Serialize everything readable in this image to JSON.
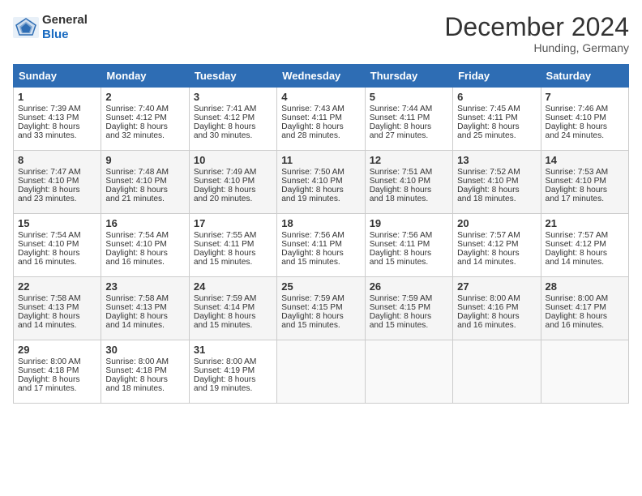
{
  "header": {
    "logo_general": "General",
    "logo_blue": "Blue",
    "title": "December 2024",
    "location": "Hunding, Germany"
  },
  "days_of_week": [
    "Sunday",
    "Monday",
    "Tuesday",
    "Wednesday",
    "Thursday",
    "Friday",
    "Saturday"
  ],
  "weeks": [
    [
      {
        "day": "1",
        "lines": [
          "Sunrise: 7:39 AM",
          "Sunset: 4:13 PM",
          "Daylight: 8 hours",
          "and 33 minutes."
        ]
      },
      {
        "day": "2",
        "lines": [
          "Sunrise: 7:40 AM",
          "Sunset: 4:12 PM",
          "Daylight: 8 hours",
          "and 32 minutes."
        ]
      },
      {
        "day": "3",
        "lines": [
          "Sunrise: 7:41 AM",
          "Sunset: 4:12 PM",
          "Daylight: 8 hours",
          "and 30 minutes."
        ]
      },
      {
        "day": "4",
        "lines": [
          "Sunrise: 7:43 AM",
          "Sunset: 4:11 PM",
          "Daylight: 8 hours",
          "and 28 minutes."
        ]
      },
      {
        "day": "5",
        "lines": [
          "Sunrise: 7:44 AM",
          "Sunset: 4:11 PM",
          "Daylight: 8 hours",
          "and 27 minutes."
        ]
      },
      {
        "day": "6",
        "lines": [
          "Sunrise: 7:45 AM",
          "Sunset: 4:11 PM",
          "Daylight: 8 hours",
          "and 25 minutes."
        ]
      },
      {
        "day": "7",
        "lines": [
          "Sunrise: 7:46 AM",
          "Sunset: 4:10 PM",
          "Daylight: 8 hours",
          "and 24 minutes."
        ]
      }
    ],
    [
      {
        "day": "8",
        "lines": [
          "Sunrise: 7:47 AM",
          "Sunset: 4:10 PM",
          "Daylight: 8 hours",
          "and 23 minutes."
        ]
      },
      {
        "day": "9",
        "lines": [
          "Sunrise: 7:48 AM",
          "Sunset: 4:10 PM",
          "Daylight: 8 hours",
          "and 21 minutes."
        ]
      },
      {
        "day": "10",
        "lines": [
          "Sunrise: 7:49 AM",
          "Sunset: 4:10 PM",
          "Daylight: 8 hours",
          "and 20 minutes."
        ]
      },
      {
        "day": "11",
        "lines": [
          "Sunrise: 7:50 AM",
          "Sunset: 4:10 PM",
          "Daylight: 8 hours",
          "and 19 minutes."
        ]
      },
      {
        "day": "12",
        "lines": [
          "Sunrise: 7:51 AM",
          "Sunset: 4:10 PM",
          "Daylight: 8 hours",
          "and 18 minutes."
        ]
      },
      {
        "day": "13",
        "lines": [
          "Sunrise: 7:52 AM",
          "Sunset: 4:10 PM",
          "Daylight: 8 hours",
          "and 18 minutes."
        ]
      },
      {
        "day": "14",
        "lines": [
          "Sunrise: 7:53 AM",
          "Sunset: 4:10 PM",
          "Daylight: 8 hours",
          "and 17 minutes."
        ]
      }
    ],
    [
      {
        "day": "15",
        "lines": [
          "Sunrise: 7:54 AM",
          "Sunset: 4:10 PM",
          "Daylight: 8 hours",
          "and 16 minutes."
        ]
      },
      {
        "day": "16",
        "lines": [
          "Sunrise: 7:54 AM",
          "Sunset: 4:10 PM",
          "Daylight: 8 hours",
          "and 16 minutes."
        ]
      },
      {
        "day": "17",
        "lines": [
          "Sunrise: 7:55 AM",
          "Sunset: 4:11 PM",
          "Daylight: 8 hours",
          "and 15 minutes."
        ]
      },
      {
        "day": "18",
        "lines": [
          "Sunrise: 7:56 AM",
          "Sunset: 4:11 PM",
          "Daylight: 8 hours",
          "and 15 minutes."
        ]
      },
      {
        "day": "19",
        "lines": [
          "Sunrise: 7:56 AM",
          "Sunset: 4:11 PM",
          "Daylight: 8 hours",
          "and 15 minutes."
        ]
      },
      {
        "day": "20",
        "lines": [
          "Sunrise: 7:57 AM",
          "Sunset: 4:12 PM",
          "Daylight: 8 hours",
          "and 14 minutes."
        ]
      },
      {
        "day": "21",
        "lines": [
          "Sunrise: 7:57 AM",
          "Sunset: 4:12 PM",
          "Daylight: 8 hours",
          "and 14 minutes."
        ]
      }
    ],
    [
      {
        "day": "22",
        "lines": [
          "Sunrise: 7:58 AM",
          "Sunset: 4:13 PM",
          "Daylight: 8 hours",
          "and 14 minutes."
        ]
      },
      {
        "day": "23",
        "lines": [
          "Sunrise: 7:58 AM",
          "Sunset: 4:13 PM",
          "Daylight: 8 hours",
          "and 14 minutes."
        ]
      },
      {
        "day": "24",
        "lines": [
          "Sunrise: 7:59 AM",
          "Sunset: 4:14 PM",
          "Daylight: 8 hours",
          "and 15 minutes."
        ]
      },
      {
        "day": "25",
        "lines": [
          "Sunrise: 7:59 AM",
          "Sunset: 4:15 PM",
          "Daylight: 8 hours",
          "and 15 minutes."
        ]
      },
      {
        "day": "26",
        "lines": [
          "Sunrise: 7:59 AM",
          "Sunset: 4:15 PM",
          "Daylight: 8 hours",
          "and 15 minutes."
        ]
      },
      {
        "day": "27",
        "lines": [
          "Sunrise: 8:00 AM",
          "Sunset: 4:16 PM",
          "Daylight: 8 hours",
          "and 16 minutes."
        ]
      },
      {
        "day": "28",
        "lines": [
          "Sunrise: 8:00 AM",
          "Sunset: 4:17 PM",
          "Daylight: 8 hours",
          "and 16 minutes."
        ]
      }
    ],
    [
      {
        "day": "29",
        "lines": [
          "Sunrise: 8:00 AM",
          "Sunset: 4:18 PM",
          "Daylight: 8 hours",
          "and 17 minutes."
        ]
      },
      {
        "day": "30",
        "lines": [
          "Sunrise: 8:00 AM",
          "Sunset: 4:18 PM",
          "Daylight: 8 hours",
          "and 18 minutes."
        ]
      },
      {
        "day": "31",
        "lines": [
          "Sunrise: 8:00 AM",
          "Sunset: 4:19 PM",
          "Daylight: 8 hours",
          "and 19 minutes."
        ]
      },
      {
        "day": "",
        "lines": []
      },
      {
        "day": "",
        "lines": []
      },
      {
        "day": "",
        "lines": []
      },
      {
        "day": "",
        "lines": []
      }
    ]
  ]
}
